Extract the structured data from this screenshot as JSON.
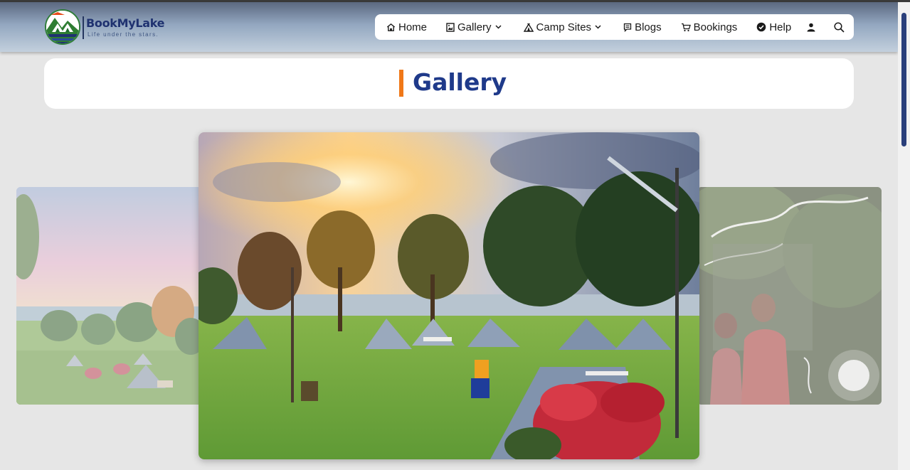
{
  "brand": {
    "name": "BookMyLake",
    "tagline": "Life under the stars."
  },
  "nav": {
    "items": [
      {
        "label": "Home",
        "icon": "home-icon"
      },
      {
        "label": "Gallery",
        "icon": "gallery-icon",
        "has_dropdown": true
      },
      {
        "label": "Camp Sites",
        "icon": "tent-icon",
        "has_dropdown": true
      },
      {
        "label": "Blogs",
        "icon": "blog-icon"
      },
      {
        "label": "Bookings",
        "icon": "cart-icon"
      },
      {
        "label": "Help",
        "icon": "check-badge-icon"
      }
    ],
    "account_icon": "user-icon",
    "search_icon": "search-icon"
  },
  "page": {
    "title": "Gallery"
  },
  "carousel": {
    "slides": [
      {
        "position": "previous",
        "subject": "lakeside-tents"
      },
      {
        "position": "active",
        "subject": "camp-sunset-tents"
      },
      {
        "position": "next",
        "subject": "couple-with-lights"
      }
    ]
  },
  "colors": {
    "accent": "#f07818",
    "title": "#1f3a8a",
    "brand": "#1f3270"
  }
}
